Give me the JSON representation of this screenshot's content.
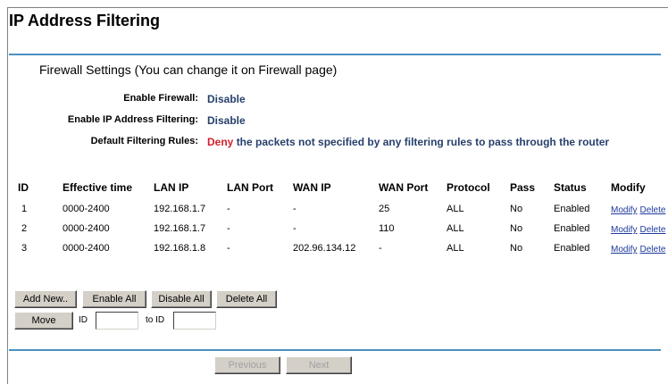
{
  "page": {
    "title": "IP Address Filtering"
  },
  "firewall": {
    "section_title": "Firewall Settings (You can change it on Firewall page)",
    "enable_firewall_label": "Enable Firewall:",
    "enable_firewall_value": "Disable",
    "enable_ip_filtering_label": "Enable IP Address Filtering:",
    "enable_ip_filtering_value": "Disable",
    "default_rules_label": "Default Filtering Rules:",
    "default_rules_action": "Deny",
    "default_rules_text": "the packets not specified by any filtering rules to pass through the router"
  },
  "table": {
    "headers": [
      "ID",
      "Effective time",
      "LAN IP",
      "LAN Port",
      "WAN IP",
      "WAN Port",
      "Protocol",
      "Pass",
      "Status",
      "Modify"
    ],
    "rows": [
      {
        "id": "1",
        "time": "0000-2400",
        "lan_ip": "192.168.1.7",
        "lan_port": "-",
        "wan_ip": "-",
        "wan_port": "25",
        "protocol": "ALL",
        "pass": "No",
        "status": "Enabled",
        "modify": "Modify",
        "delete": "Delete"
      },
      {
        "id": "2",
        "time": "0000-2400",
        "lan_ip": "192.168.1.7",
        "lan_port": "-",
        "wan_ip": "-",
        "wan_port": "110",
        "protocol": "ALL",
        "pass": "No",
        "status": "Enabled",
        "modify": "Modify",
        "delete": "Delete"
      },
      {
        "id": "3",
        "time": "0000-2400",
        "lan_ip": "192.168.1.8",
        "lan_port": "-",
        "wan_ip": "202.96.134.12",
        "wan_port": "-",
        "protocol": "ALL",
        "pass": "No",
        "status": "Enabled",
        "modify": "Modify",
        "delete": "Delete"
      }
    ]
  },
  "actions": {
    "add_new": "Add New..",
    "enable_all": "Enable All",
    "disable_all": "Disable All",
    "delete_all": "Delete All",
    "move": "Move",
    "id_label": "ID",
    "id_value": "",
    "to_id_label": "to ID",
    "to_id_value": ""
  },
  "pager": {
    "previous": "Previous",
    "next": "Next"
  },
  "colors": {
    "rule_line": "#4a90c0",
    "value_blue": "#27406c",
    "deny_red": "#d2202f",
    "link_blue": "#1f3a9c"
  }
}
